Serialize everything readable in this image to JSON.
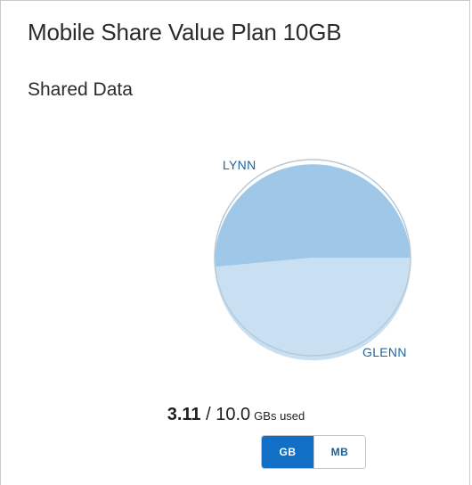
{
  "plan": {
    "title": "Mobile Share Value Plan 10GB"
  },
  "section": {
    "title": "Shared Data"
  },
  "pie": {
    "colors": {
      "lynn": "#9fc8e8",
      "glenn": "#c9e0f3",
      "border": "#b8c9d6"
    },
    "labels": {
      "lynn": "LYNN",
      "glenn": "GLENN"
    }
  },
  "usage": {
    "used": "3.11",
    "separator": " / ",
    "total": "10.0",
    "unit": "GBs used"
  },
  "unit_toggle": {
    "options": [
      {
        "label": "GB",
        "selected": true
      },
      {
        "label": "MB",
        "selected": false
      }
    ]
  }
}
